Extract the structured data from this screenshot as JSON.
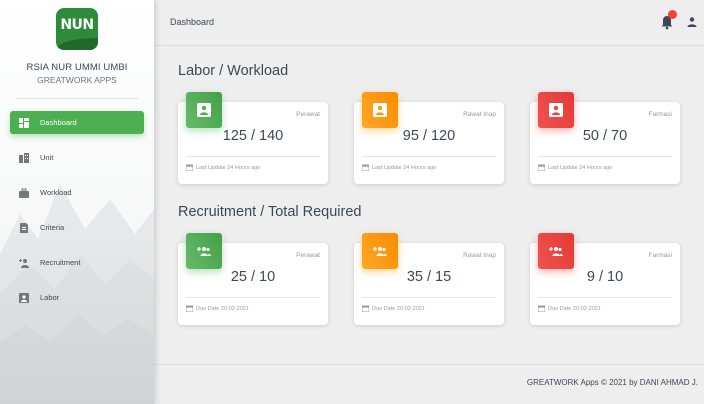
{
  "sidebar": {
    "logo_text": "NUN",
    "brand_title": "RSIA NUR UMMI UMBI",
    "brand_subtitle": "GREATWORK APPS",
    "items": [
      {
        "label": "Dashboard",
        "icon": "dashboard-icon",
        "active": true
      },
      {
        "label": "Unit",
        "icon": "unit-icon",
        "active": false
      },
      {
        "label": "Workload",
        "icon": "workload-icon",
        "active": false
      },
      {
        "label": "Criteria",
        "icon": "criteria-icon",
        "active": false
      },
      {
        "label": "Recruitment",
        "icon": "recruitment-icon",
        "active": false
      },
      {
        "label": "Labor",
        "icon": "labor-icon",
        "active": false
      }
    ]
  },
  "topbar": {
    "title": "Dashboard",
    "notification_icon": "bell-icon",
    "user_icon": "person-icon"
  },
  "labor": {
    "title": "Labor / Workload",
    "cards": [
      {
        "category": "Perawat",
        "value": "125 / 140",
        "footer": "Last Update 24 Hours ago",
        "color": "#4caf50",
        "icon": "account-box-icon"
      },
      {
        "category": "Rawat Inap",
        "value": "95 / 120",
        "footer": "Last Update 24 Hours ago",
        "color": "#ff9800",
        "icon": "account-box-icon"
      },
      {
        "category": "Farmasi",
        "value": "50 / 70",
        "footer": "Last Update 24 Hours ago",
        "color": "#f44336",
        "icon": "account-box-icon"
      }
    ]
  },
  "recruitment": {
    "title": "Recruitment / Total Required",
    "cards": [
      {
        "category": "Perawat",
        "value": "25 / 10",
        "footer": "Due Date 20-02-2021",
        "color": "#4caf50",
        "icon": "group-add-icon"
      },
      {
        "category": "Rawat Inap",
        "value": "35 / 15",
        "footer": "Due Date 20-02-2021",
        "color": "#ff9800",
        "icon": "group-add-icon"
      },
      {
        "category": "Farmasi",
        "value": "9 / 10",
        "footer": "Due Date 20-02-2021",
        "color": "#f44336",
        "icon": "group-add-icon"
      }
    ]
  },
  "footer": {
    "text": "GREATWORK Apps © 2021 by DANI AHMAD J."
  },
  "colors": {
    "accent_green": "#4caf50",
    "accent_orange": "#ff9800",
    "accent_red": "#f44336"
  }
}
